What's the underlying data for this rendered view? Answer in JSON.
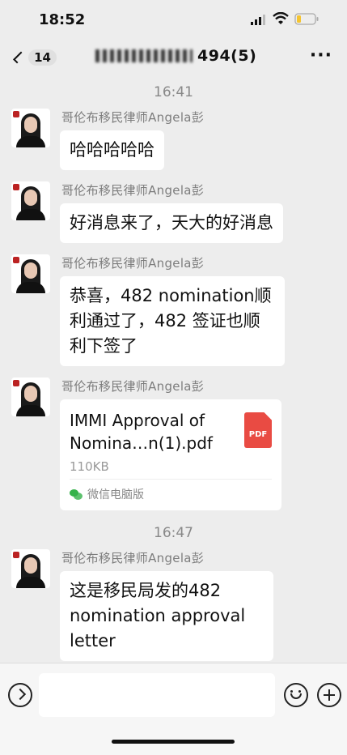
{
  "status_bar": {
    "time": "18:52"
  },
  "nav": {
    "back_count": "14",
    "title_suffix": "494(5)"
  },
  "chat": {
    "timestamp_1": "16:41",
    "timestamp_2": "16:47",
    "messages": [
      {
        "sender": "哥伦布移民律师Angela彭",
        "text": "哈哈哈哈哈"
      },
      {
        "sender": "哥伦布移民律师Angela彭",
        "text": "好消息来了，天大的好消息"
      },
      {
        "sender": "哥伦布移民律师Angela彭",
        "text": "恭喜，482 nomination顺利通过了，482 签证也顺利下签了"
      },
      {
        "sender": "哥伦布移民律师Angela彭",
        "file": {
          "name": "IMMI Approval of Nomina…n(1).pdf",
          "size": "110KB",
          "source": "微信电脑版",
          "icon_label": "PDF"
        }
      },
      {
        "sender": "哥伦布移民律师Angela彭",
        "text": "这是移民局发的482 nomination approval letter"
      }
    ]
  },
  "colors": {
    "background": "#ededed",
    "bubble": "#ffffff",
    "pdf_red": "#e94b43",
    "wechat_green": "#35b24a"
  }
}
